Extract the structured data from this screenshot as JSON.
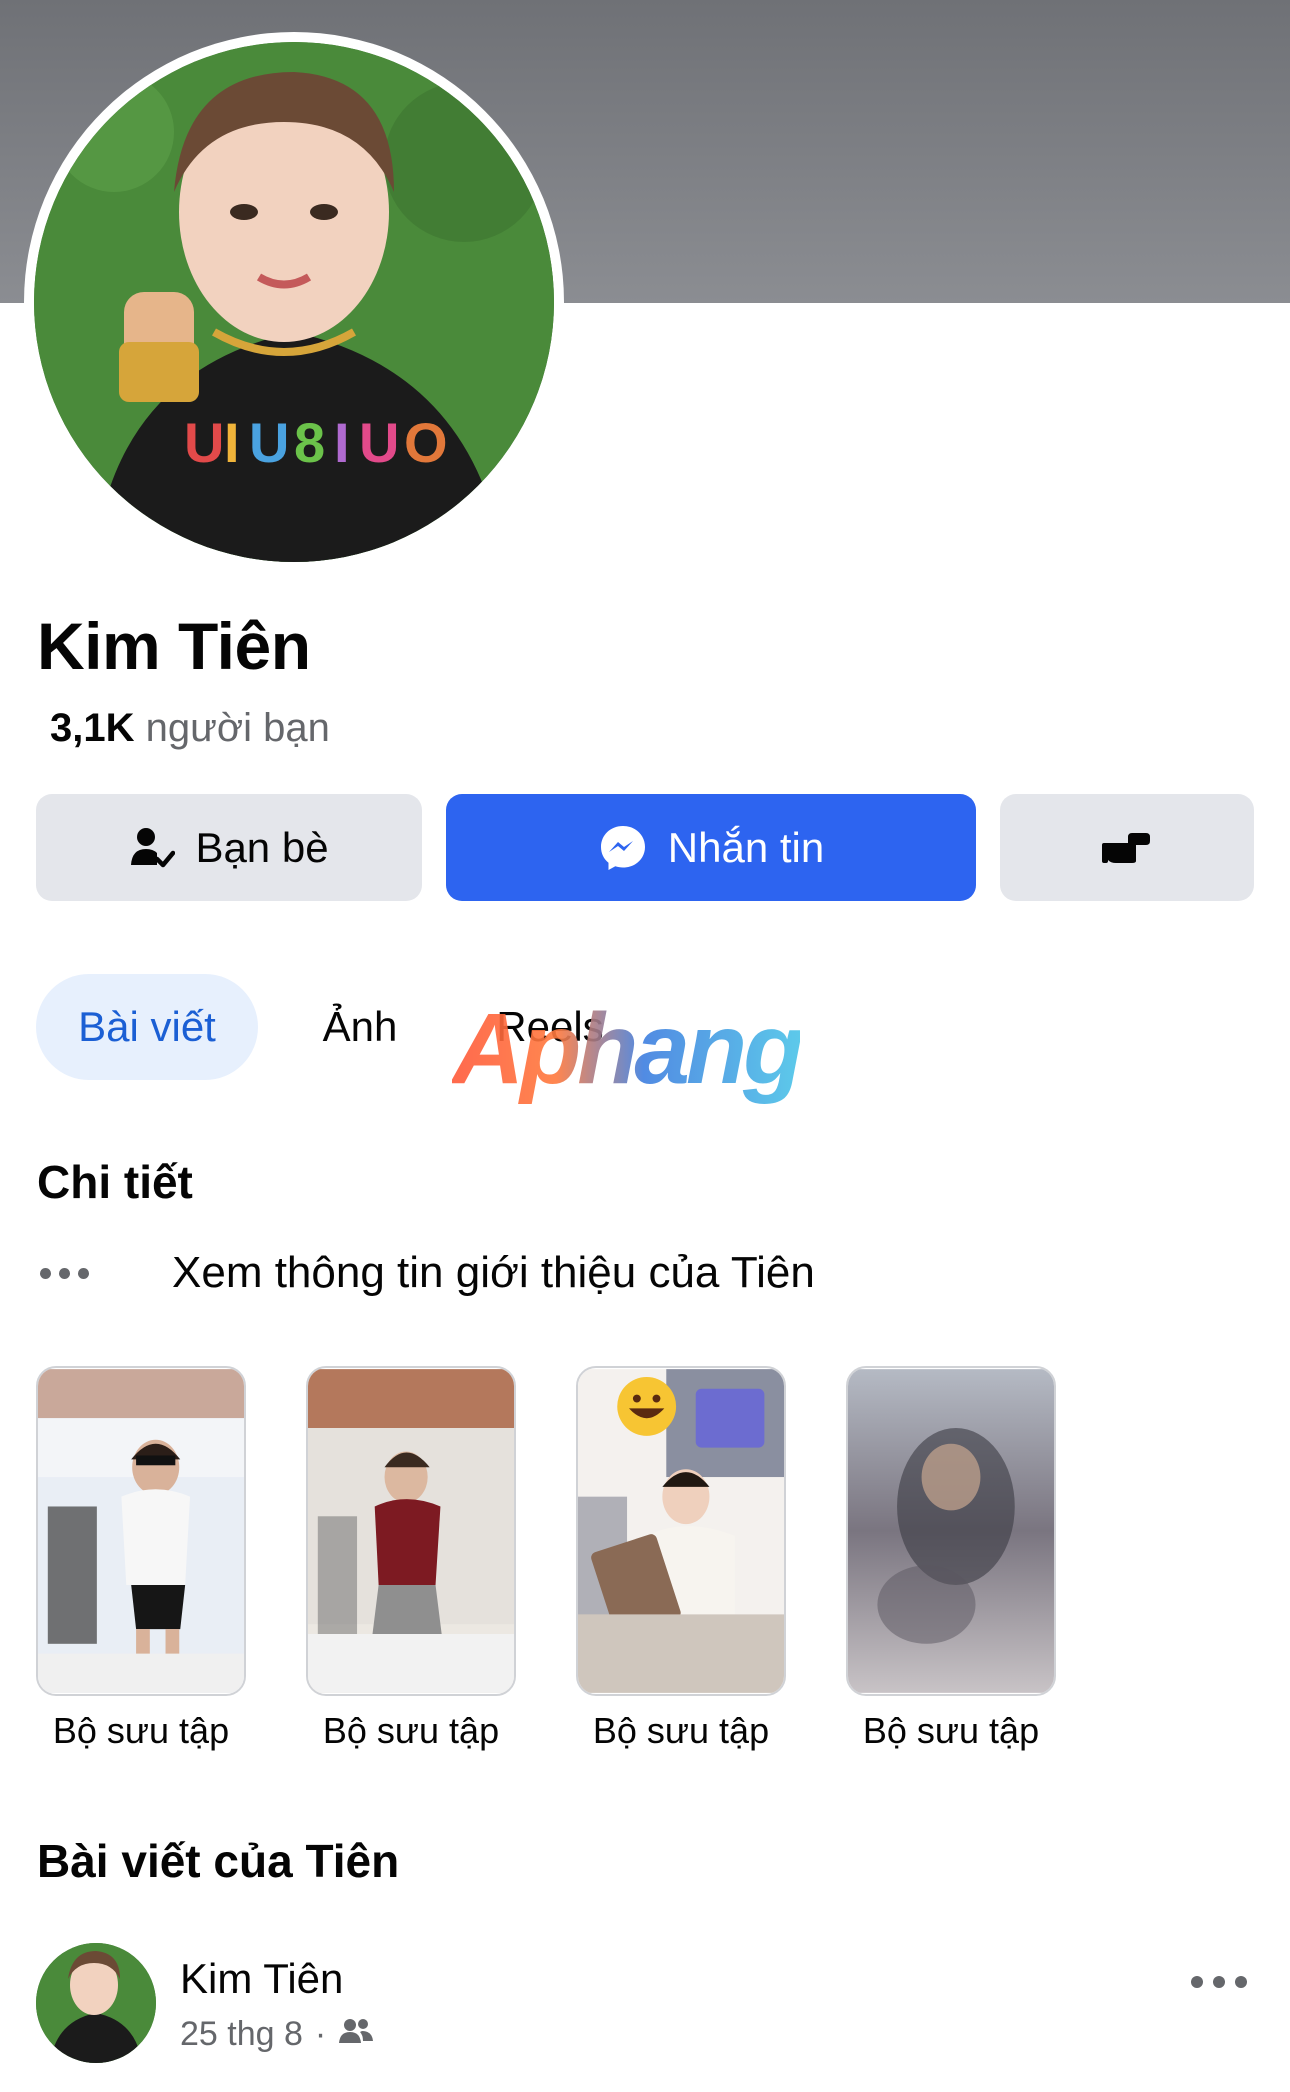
{
  "profile": {
    "name": "Kim Tiên",
    "friend_count": "3,1K",
    "friend_label": "người bạn"
  },
  "actions": {
    "friends_label": "Bạn bè",
    "message_label": "Nhắn tin"
  },
  "tabs": [
    {
      "label": "Bài viết",
      "active": true
    },
    {
      "label": "Ảnh",
      "active": false
    },
    {
      "label": "Reels",
      "active": false
    }
  ],
  "watermark": "Aphang",
  "details": {
    "title": "Chi tiết",
    "about_link": "Xem thông tin giới thiệu của Tiên"
  },
  "collections": [
    {
      "label": "Bộ sưu tập"
    },
    {
      "label": "Bộ sưu tập"
    },
    {
      "label": "Bộ sưu tập"
    },
    {
      "label": "Bộ sưu tập"
    }
  ],
  "posts": {
    "title": "Bài viết của Tiên",
    "first": {
      "author": "Kim Tiên",
      "date": "25 thg 8",
      "separator": "·",
      "audience_icon": "friends-audience-icon"
    }
  },
  "colors": {
    "primary": "#2d64f0",
    "tab_active_bg": "#e7f0fd",
    "tab_active_text": "#1b5fd4",
    "secondary_button": "#e4e6eb",
    "muted_text": "#65676b",
    "cover": "#7d7f84"
  }
}
